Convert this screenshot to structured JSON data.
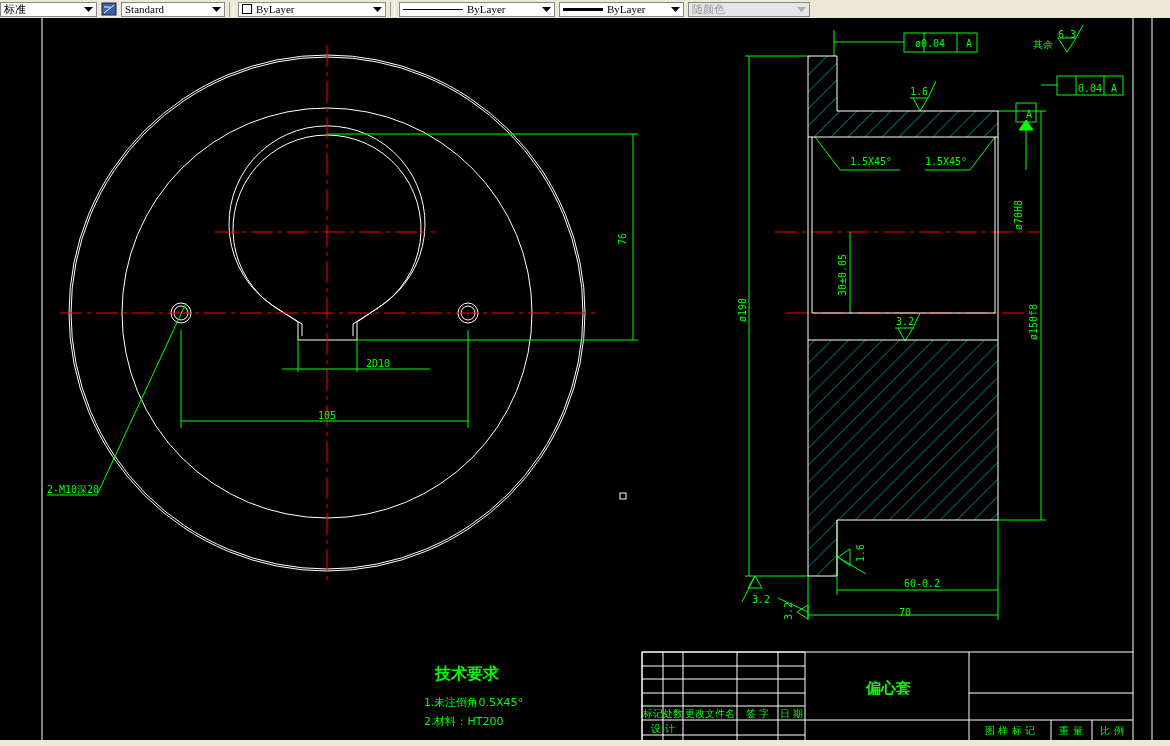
{
  "toolbar": [
    {
      "kind": "text",
      "value": "标准",
      "disabled": false
    },
    {
      "kind": "dimstyle",
      "value": "Standard",
      "disabled": false
    },
    {
      "kind": "layer",
      "value": "ByLayer",
      "disabled": false
    },
    {
      "kind": "linetype",
      "value": "ByLayer",
      "disabled": false
    },
    {
      "kind": "lineweight",
      "value": "ByLayer",
      "disabled": false
    },
    {
      "kind": "plotstyle",
      "value": "随颜色",
      "disabled": true
    }
  ],
  "drawing": {
    "annotations": [
      "76",
      "2D10",
      "105",
      "2-M10深20",
      "ø190",
      "ø0.04",
      "A",
      "其余",
      "6.3",
      "1.6",
      "0.04",
      "A",
      "A",
      "1.5X45°",
      "1.5X45°",
      "ø70H8",
      "30±0.05",
      "3.2",
      "ø150f8",
      "1.6",
      "3.2",
      "3.2",
      "60-0.2",
      "70"
    ]
  },
  "technical_requirements": {
    "heading": "技术要求",
    "items": [
      "1.未注倒角0.5X45°",
      "2.材料：HT200"
    ]
  },
  "title_block": {
    "part_name": "偏心套",
    "revision_headers": [
      "标记",
      "处数",
      "更改文件名",
      "签 字",
      "日 期"
    ],
    "designer_label": "设 计",
    "info_headers": [
      "图 样 标 记",
      "重 量",
      "比 例"
    ]
  }
}
